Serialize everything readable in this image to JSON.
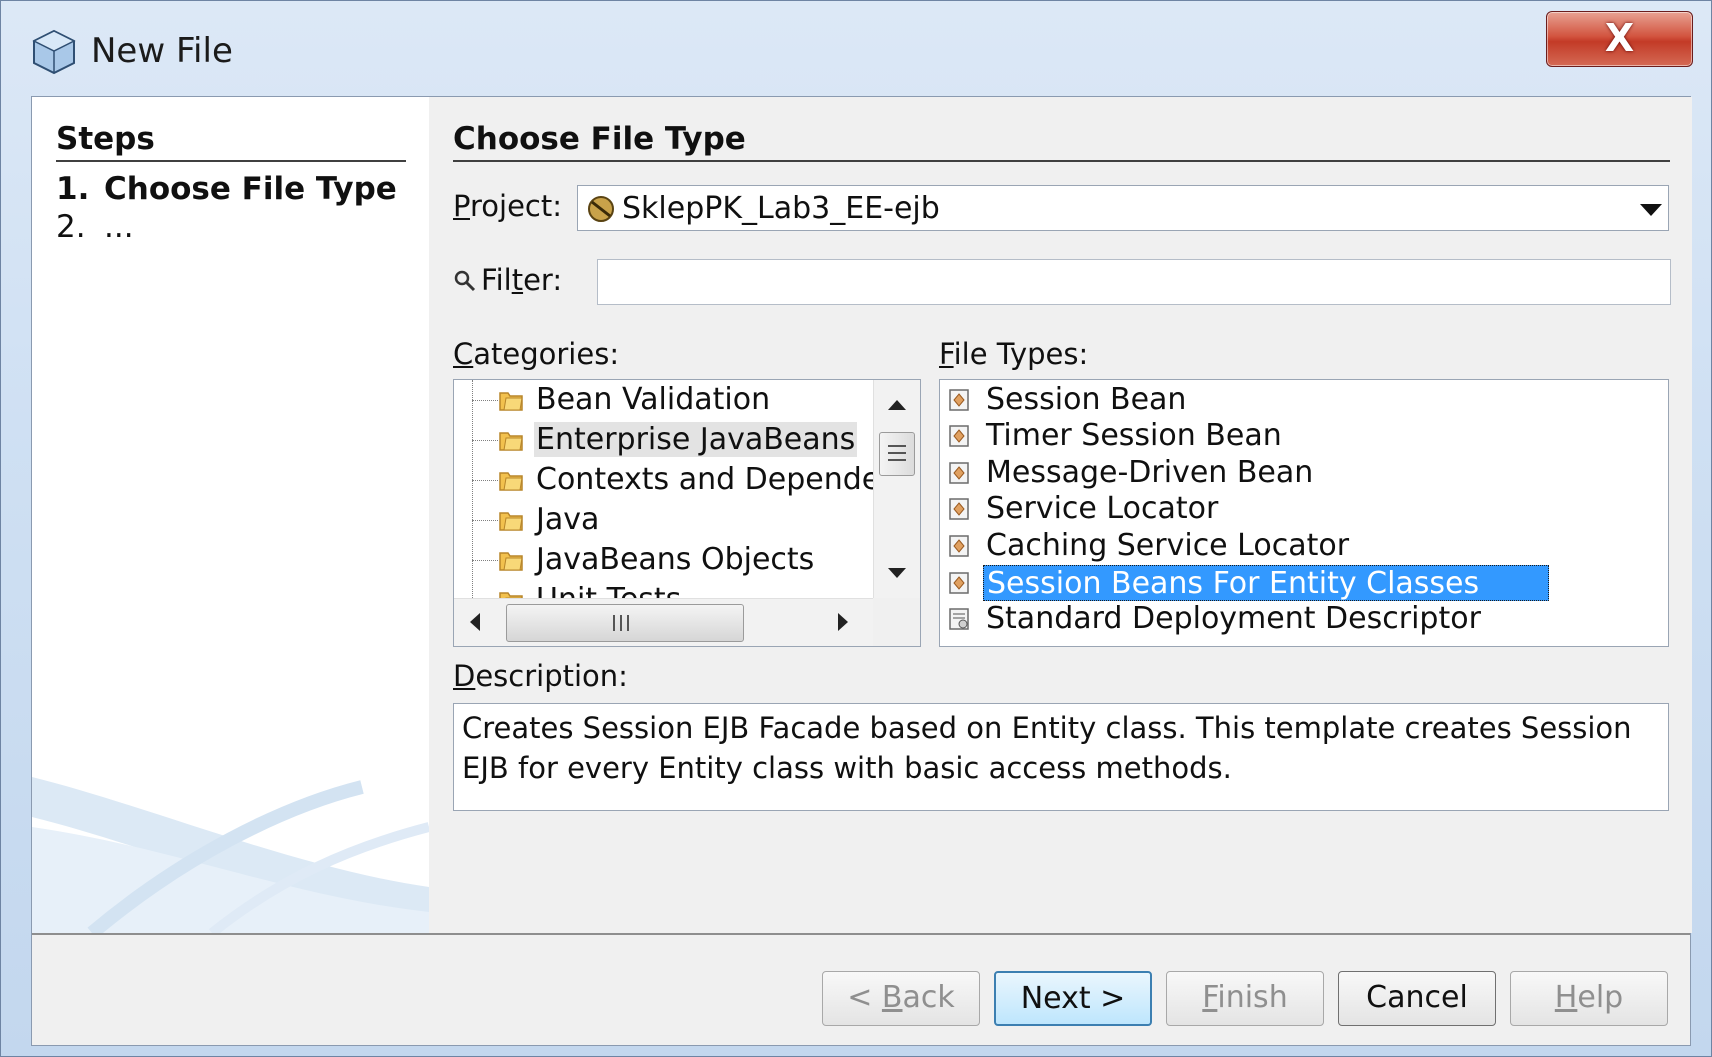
{
  "window": {
    "title": "New File",
    "close_glyph": "X"
  },
  "steps": {
    "title": "Steps",
    "items": [
      {
        "num": "1.",
        "label": "Choose File Type",
        "current": true
      },
      {
        "num": "2.",
        "label": "...",
        "current": false
      }
    ]
  },
  "main": {
    "section_title": "Choose File Type",
    "project": {
      "label_prefix": "",
      "label_mnemonic": "P",
      "label_rest": "roject:",
      "value": "SklepPK_Lab3_EE-ejb"
    },
    "filter": {
      "label_pre": "Fil",
      "label_mnemonic": "t",
      "label_post": "er:",
      "value": ""
    },
    "categories": {
      "label_mnemonic": "C",
      "label_rest": "ategories:",
      "items": [
        {
          "label": "Bean Validation",
          "selected": false
        },
        {
          "label": "Enterprise JavaBeans",
          "selected": true
        },
        {
          "label": "Contexts and Dependency",
          "selected": false
        },
        {
          "label": "Java",
          "selected": false
        },
        {
          "label": "JavaBeans Objects",
          "selected": false
        },
        {
          "label": "Unit Tests",
          "selected": false
        }
      ]
    },
    "file_types": {
      "label_mnemonic": "F",
      "label_rest": "ile Types:",
      "items": [
        {
          "label": "Session Bean",
          "selected": false,
          "icon": "bean-icon"
        },
        {
          "label": "Timer Session Bean",
          "selected": false,
          "icon": "bean-icon"
        },
        {
          "label": "Message-Driven Bean",
          "selected": false,
          "icon": "bean-icon"
        },
        {
          "label": "Service Locator",
          "selected": false,
          "icon": "bean-icon"
        },
        {
          "label": "Caching Service Locator",
          "selected": false,
          "icon": "bean-icon"
        },
        {
          "label": "Session Beans For Entity Classes",
          "selected": true,
          "icon": "bean-icon"
        },
        {
          "label": "Standard Deployment Descriptor",
          "selected": false,
          "icon": "descriptor-icon"
        }
      ]
    },
    "description": {
      "label_mnemonic": "D",
      "label_rest": "escription:",
      "text": "Creates Session EJB Facade based on Entity class. This template creates Session EJB for every Entity class with basic access methods."
    }
  },
  "buttons": {
    "back": {
      "pre": "< ",
      "mnemonic": "B",
      "post": "ack"
    },
    "next": {
      "label": "Next >"
    },
    "finish": {
      "mnemonic": "F",
      "post": "inish"
    },
    "cancel": {
      "label": "Cancel"
    },
    "help": {
      "mnemonic": "H",
      "post": "elp"
    }
  },
  "colors": {
    "selection": "#3399ff",
    "close_button": "#c33a27"
  }
}
